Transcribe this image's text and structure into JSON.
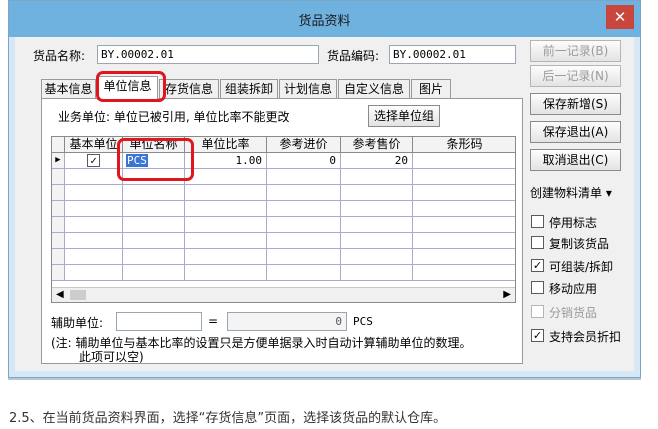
{
  "window": {
    "title": "货品资料",
    "close_glyph": "✕"
  },
  "header": {
    "name_label": "货品名称:",
    "name_value": "BY.00002.01",
    "code_label": "货品编码:",
    "code_value": "BY.00002.01"
  },
  "tabs": [
    {
      "label": "基本信息"
    },
    {
      "label": "单位信息",
      "active": true
    },
    {
      "label": "存货信息"
    },
    {
      "label": "组装拆卸"
    },
    {
      "label": "计划信息"
    },
    {
      "label": "自定义信息"
    },
    {
      "label": "图片"
    }
  ],
  "unit_panel": {
    "business_unit_text": "业务单位: 单位已被引用, 单位比率不能更改",
    "select_unit_group_button": "选择单位组",
    "grid": {
      "columns": [
        "基本单位",
        "单位名称",
        "单位比率",
        "参考进价",
        "参考售价",
        "条形码"
      ],
      "rows": [
        {
          "base_unit_checked": "✓",
          "unit_name": "PCS",
          "ratio": "1.00",
          "ref_purchase": "0",
          "ref_sale": "20",
          "barcode": ""
        }
      ]
    },
    "aux_unit_label": "辅助单位:",
    "aux_unit_value": "",
    "equals": "=",
    "aux_qty": "0",
    "aux_unit_suffix": "PCS",
    "note_line1": "(注: 辅助单位与基本比率的设置只是方便单据录入时自动计算辅助单位的数理。",
    "note_line2": "此项可以空)"
  },
  "right_buttons": {
    "prev_record": "前一记录(B)",
    "next_record": "后一记录(N)",
    "save_new": "保存新增(S)",
    "save_exit": "保存退出(A)",
    "cancel_exit": "取消退出(C)",
    "create_bom": "创建物料清单 ▾"
  },
  "options": [
    {
      "label": "停用标志",
      "check": "",
      "disabled": false
    },
    {
      "label": "复制该货品",
      "check": "",
      "disabled": false
    },
    {
      "label": "可组装/拆卸",
      "check": "✓",
      "disabled": false
    },
    {
      "label": "移动应用",
      "check": "",
      "disabled": false
    },
    {
      "label": "分销货品",
      "check": "",
      "disabled": true
    },
    {
      "label": "支持会员折扣",
      "check": "✓",
      "disabled": false
    }
  ],
  "caption": "2.5、在当前货品资料界面，选择“存货信息”页面，选择该货品的默认仓库。",
  "colors": {
    "title_bar": "#6fb2df",
    "highlight_red": "#e0161c",
    "selection_blue": "#3875d7"
  }
}
